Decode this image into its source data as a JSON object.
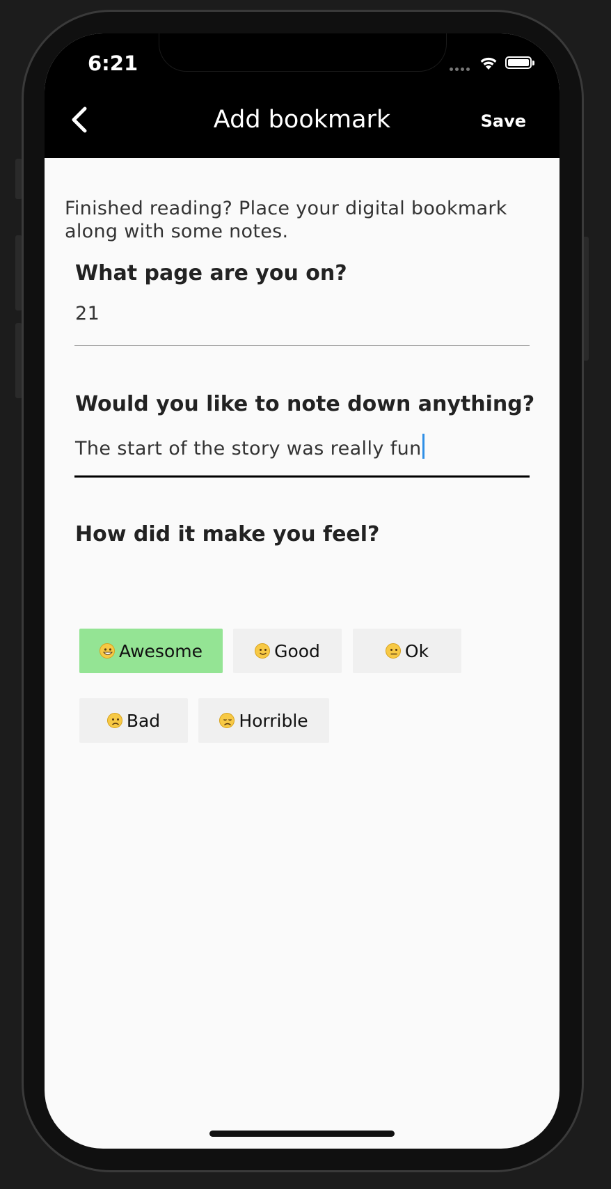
{
  "status_bar": {
    "time": "6:21"
  },
  "nav": {
    "title": "Add bookmark",
    "save_label": "Save",
    "back_icon": "chevron-left-icon"
  },
  "intro_text": "Finished reading? Place your digital bookmark along with some notes.",
  "page_field": {
    "label": "What page are you on?",
    "value": "21"
  },
  "notes_field": {
    "label": "Would you like to note down anything?",
    "value": "The start of the story was really fun"
  },
  "feeling": {
    "label": "How did it make you feel?",
    "options": [
      {
        "label": "Awesome",
        "icon": "grinning-face-icon",
        "selected": true
      },
      {
        "label": "Good",
        "icon": "slightly-smiling-face-icon",
        "selected": false
      },
      {
        "label": "Ok",
        "icon": "neutral-face-icon",
        "selected": false
      },
      {
        "label": "Bad",
        "icon": "slightly-frowning-face-icon",
        "selected": false
      },
      {
        "label": "Horrible",
        "icon": "disappointed-face-icon",
        "selected": false
      }
    ]
  },
  "colors": {
    "appbar": "#000000",
    "selected_chip": "#94e494",
    "chip": "#f0f0f0",
    "caret": "#2f8fe6"
  }
}
